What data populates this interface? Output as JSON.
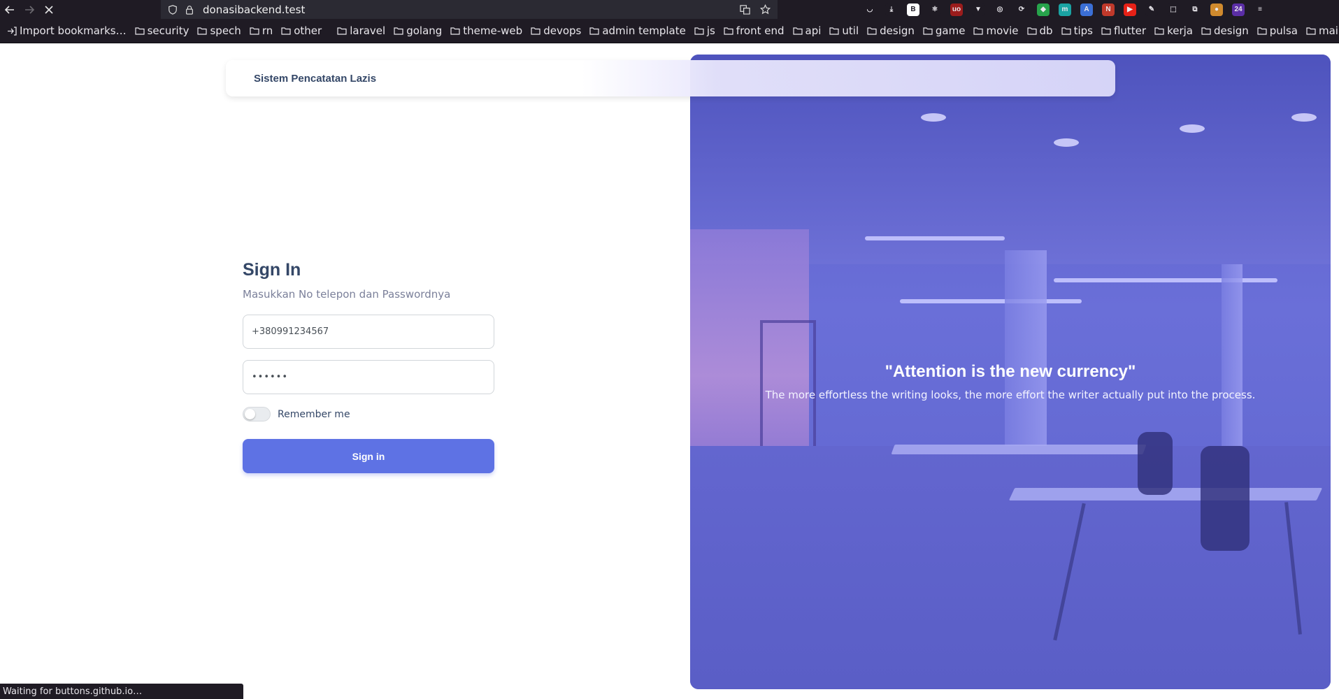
{
  "browser": {
    "url": "donasibackend.test",
    "status_text": "Waiting for buttons.github.io…",
    "bookmarks": [
      {
        "label": "Import bookmarks…",
        "icon": "import-icon"
      },
      {
        "label": "security"
      },
      {
        "label": "spech"
      },
      {
        "label": "rn"
      },
      {
        "label": "other"
      },
      {
        "label": "laravel"
      },
      {
        "label": "golang"
      },
      {
        "label": "theme-web"
      },
      {
        "label": "devops"
      },
      {
        "label": "admin template"
      },
      {
        "label": "js"
      },
      {
        "label": "front end"
      },
      {
        "label": "api"
      },
      {
        "label": "util"
      },
      {
        "label": "design"
      },
      {
        "label": "game"
      },
      {
        "label": "movie"
      },
      {
        "label": "db"
      },
      {
        "label": "tips"
      },
      {
        "label": "flutter"
      },
      {
        "label": "kerja"
      },
      {
        "label": "design"
      },
      {
        "label": "pulsa"
      },
      {
        "label": "mail server"
      }
    ],
    "extensions": [
      {
        "name": "pocket-icon",
        "color": "#1f1b24",
        "glyph": "◡"
      },
      {
        "name": "download-icon",
        "color": "#1f1b24",
        "glyph": "⤓"
      },
      {
        "name": "b-extension-icon",
        "color": "#ffffff",
        "glyph": "B"
      },
      {
        "name": "react-devtools-icon",
        "color": "#1f1b24",
        "glyph": "⚛"
      },
      {
        "name": "ublock-icon",
        "color": "#9b1c1c",
        "glyph": "uo"
      },
      {
        "name": "vue-devtools-icon",
        "color": "#1f1b24",
        "glyph": "▼"
      },
      {
        "name": "github-icon",
        "color": "#1f1b24",
        "glyph": "◎"
      },
      {
        "name": "sync-icon",
        "color": "#1f1b24",
        "glyph": "⟳"
      },
      {
        "name": "color-picker-icon",
        "color": "#27a34b",
        "glyph": "◆"
      },
      {
        "name": "m-extension-icon",
        "color": "#1aa3a3",
        "glyph": "m"
      },
      {
        "name": "translate-icon",
        "color": "#3b6fd6",
        "glyph": "A"
      },
      {
        "name": "new-badge-icon",
        "color": "#c0392b",
        "glyph": "N"
      },
      {
        "name": "youtube-icon",
        "color": "#e62117",
        "glyph": "▶"
      },
      {
        "name": "pen-icon",
        "color": "#1f1b24",
        "glyph": "✎"
      },
      {
        "name": "screenshot-icon",
        "color": "#1f1b24",
        "glyph": "⬚"
      },
      {
        "name": "extensions-icon",
        "color": "#1f1b24",
        "glyph": "⧉"
      },
      {
        "name": "cookie-icon",
        "color": "#d08a2e",
        "glyph": "●"
      },
      {
        "name": "badge-24-icon",
        "color": "#5b2ea6",
        "glyph": "24"
      },
      {
        "name": "menu-icon",
        "color": "#1f1b24",
        "glyph": "≡"
      }
    ]
  },
  "nav": {
    "brand": "Sistem Pencatatan Lazis"
  },
  "form": {
    "title": "Sign In",
    "subtitle": "Masukkan No telepon dan Passwordnya",
    "phone_value": "+380991234567",
    "password_value": "••••••",
    "remember_label": "Remember me",
    "submit_label": "Sign in"
  },
  "hero": {
    "quote": "\"Attention is the new currency\"",
    "text": "The more effortless the writing looks, the more effort the writer actually put into the process."
  },
  "colors": {
    "primary": "#5e72e4",
    "heading": "#344767",
    "hero_overlay": "#5a5ec8"
  }
}
